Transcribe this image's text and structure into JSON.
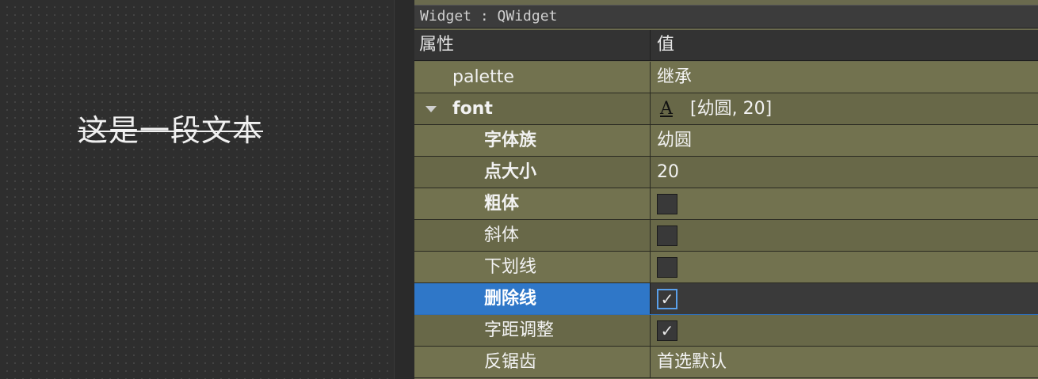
{
  "canvas": {
    "sample_text": "这是一段文本"
  },
  "object_header": "Widget : QWidget",
  "columns": {
    "property": "属性",
    "value": "值"
  },
  "properties": [
    {
      "name": "palette",
      "value": "继承"
    },
    {
      "name": "font",
      "value": "[幼圆, 20]",
      "icon": "font-icon"
    },
    {
      "name": "字体族",
      "value": "幼圆"
    },
    {
      "name": "点大小",
      "value": "20"
    },
    {
      "name": "粗体",
      "checked": false
    },
    {
      "name": "斜体",
      "checked": false
    },
    {
      "name": "下划线",
      "checked": false
    },
    {
      "name": "删除线",
      "checked": true
    },
    {
      "name": "字距调整",
      "checked": true
    },
    {
      "name": "反锯齿",
      "value": "首选默认"
    }
  ],
  "colors": {
    "selection": "#2f77c8",
    "row_bg": "#72724f",
    "canvas_bg": "#2e2e2e"
  }
}
